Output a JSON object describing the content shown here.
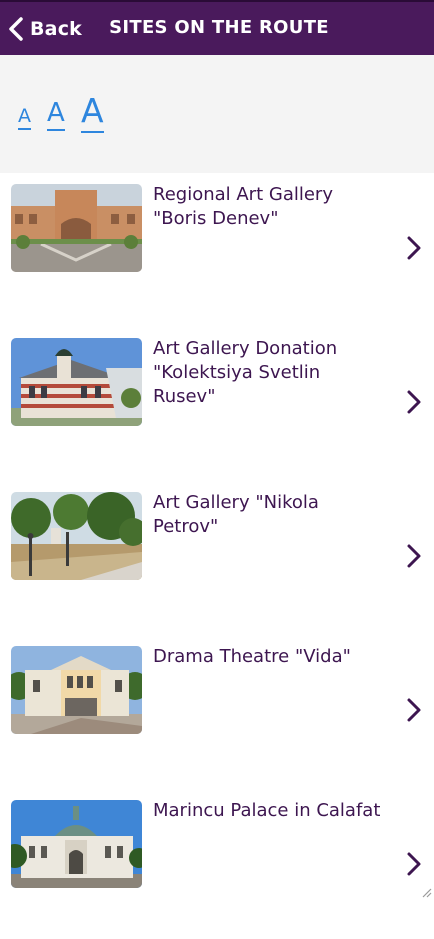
{
  "header": {
    "back_label": "Back",
    "title": "SITES ON THE ROUTE",
    "background": "#4a1a5c"
  },
  "font_size_controls": [
    {
      "label": "A",
      "size": "small"
    },
    {
      "label": "A",
      "size": "medium"
    },
    {
      "label": "A",
      "size": "large"
    }
  ],
  "sites": [
    {
      "title": "Regional Art Gallery \"Boris Denev\"",
      "icon": "chevron-right-icon"
    },
    {
      "title": "Art Gallery Donation \"Kolektsiya Svetlin Rusev\"",
      "icon": "chevron-right-icon"
    },
    {
      "title": "Art Gallery \"Nikola Petrov\"",
      "icon": "chevron-right-icon"
    },
    {
      "title": "Drama Theatre \"Vida\"",
      "icon": "chevron-right-icon"
    },
    {
      "title": "Marincu Palace in Calafat",
      "icon": "chevron-right-icon"
    }
  ],
  "colors": {
    "accent": "#2e86de",
    "title_text": "#3d1650",
    "chevron": "#3d1650"
  }
}
